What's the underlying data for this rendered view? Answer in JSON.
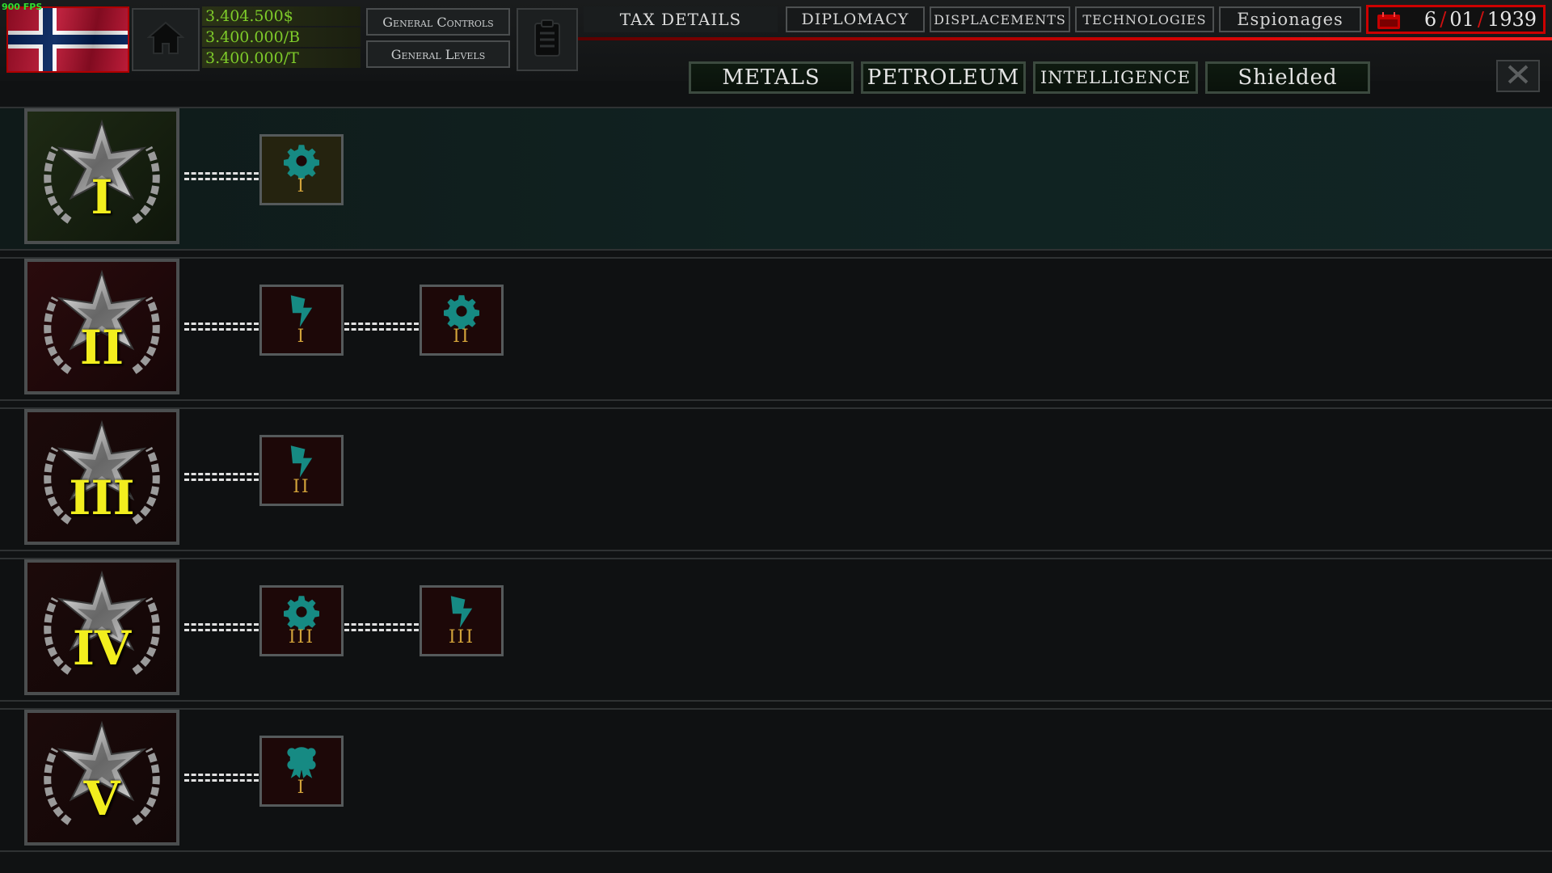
{
  "fps": "900 FPS",
  "resources": {
    "money": "3.404.500$",
    "oil": "3.400.000/B",
    "metal": "3.400.000/T"
  },
  "general": {
    "controls": "General Controls",
    "levels": "General Levels"
  },
  "tabs": {
    "tax": "TAX DETAILS",
    "diplomacy": "DIPLOMACY",
    "displacements": "DISPLACEMENTS",
    "technologies": "TECHNOLOGIES",
    "espionages": "Espionages"
  },
  "date": {
    "day": "6",
    "month": "01",
    "year": "1939"
  },
  "filters": [
    "METALS",
    "PETROLEUM",
    "INTELLIGENCE",
    "Shielded"
  ],
  "colors": {
    "accent_red": "#d00000",
    "money_green": "#7ecb2a",
    "icon_teal": "#168a83",
    "level_gold": "#d1a23a",
    "medal_numeral": "#f2ee1e"
  },
  "tiers": [
    {
      "numeral": "I",
      "nodes": [
        {
          "icon": "gear-icon",
          "level": "I"
        }
      ]
    },
    {
      "numeral": "II",
      "nodes": [
        {
          "icon": "lightning-icon",
          "level": "I"
        },
        {
          "icon": "gear-icon",
          "level": "II"
        }
      ]
    },
    {
      "numeral": "III",
      "nodes": [
        {
          "icon": "lightning-icon",
          "level": "II"
        }
      ]
    },
    {
      "numeral": "IV",
      "nodes": [
        {
          "icon": "gear-icon",
          "level": "III"
        },
        {
          "icon": "lightning-icon",
          "level": "III"
        }
      ]
    },
    {
      "numeral": "V",
      "nodes": [
        {
          "icon": "rosette-icon",
          "level": "I"
        }
      ]
    }
  ]
}
